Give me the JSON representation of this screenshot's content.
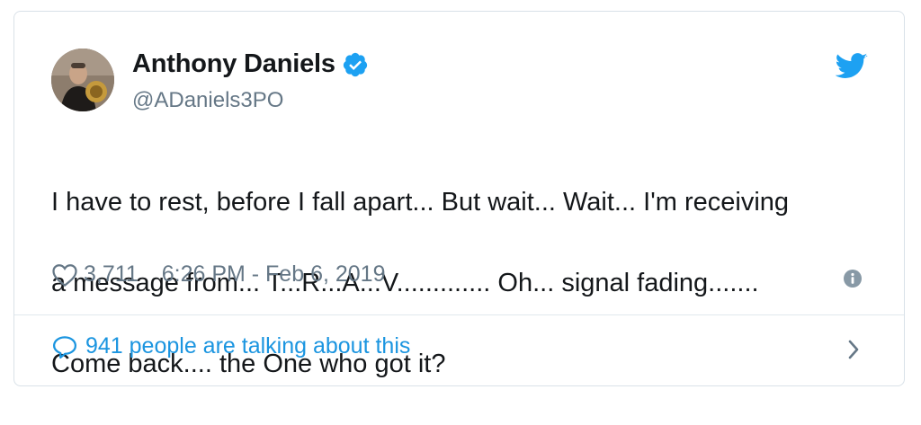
{
  "colors": {
    "text_primary": "#14171a",
    "text_secondary": "#657786",
    "accent": "#1da1f2",
    "link": "#1b95e0",
    "border": "#d9e1e8"
  },
  "author": {
    "display_name": "Anthony Daniels",
    "handle": "@ADaniels3PO",
    "verified": true,
    "avatar_icon": "avatar-photo"
  },
  "tweet": {
    "text_lines": [
      "I have to rest, before I fall apart... But wait... Wait... I'm receiving",
      "a message from... T...R...A...V............. Oh... signal fading.......",
      "Come back.... the One who got it?"
    ]
  },
  "meta": {
    "likes": "3,711",
    "timestamp": "6:26 PM - Feb 6, 2019",
    "heart_icon": "heart-outline-icon",
    "info_icon": "info-icon"
  },
  "footer": {
    "talking_text": "941 people are talking about this",
    "bubble_icon": "speech-bubble-icon",
    "chevron_icon": "chevron-right-icon"
  },
  "brand": {
    "logo_icon": "twitter-bird-icon"
  }
}
